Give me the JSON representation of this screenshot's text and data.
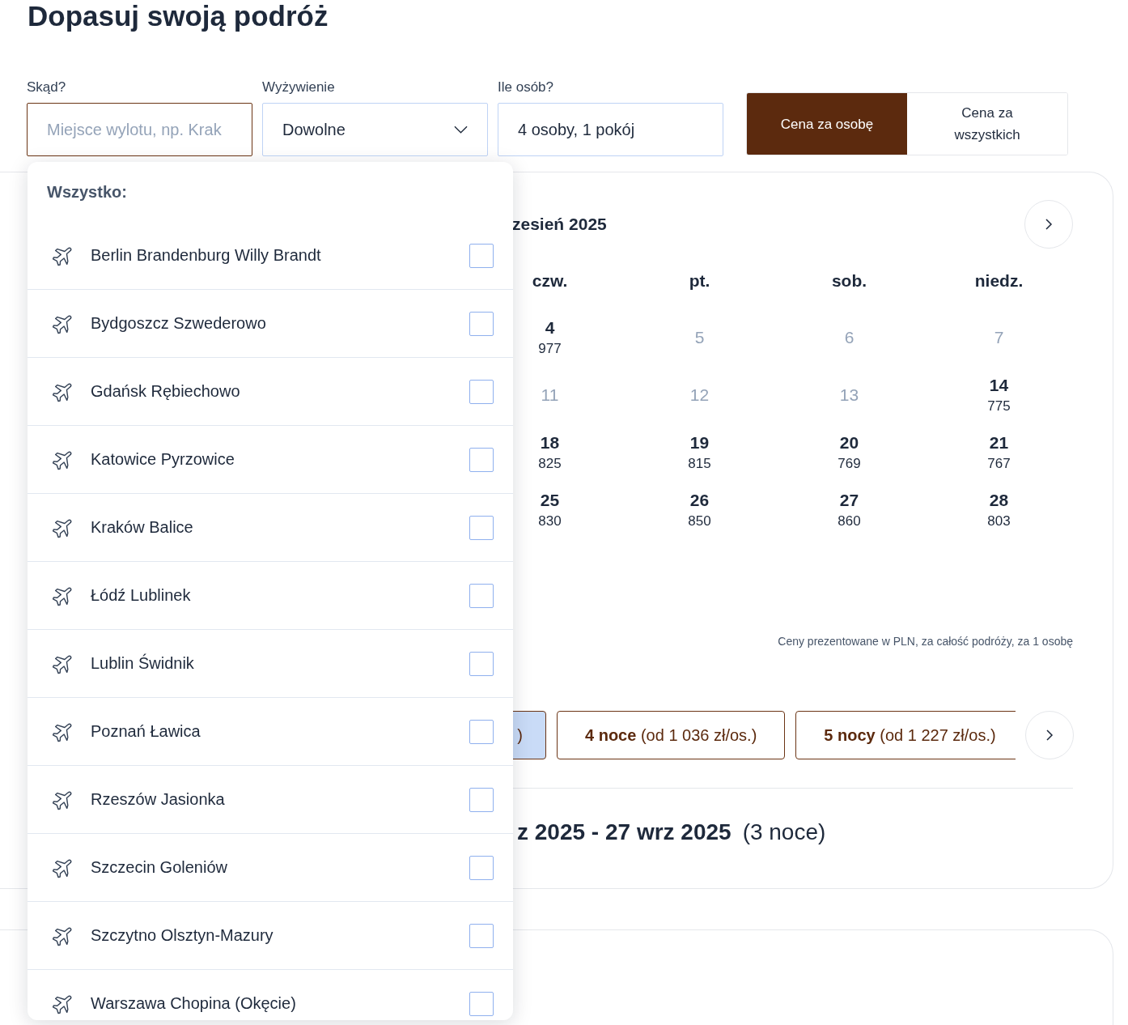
{
  "page_title": "Dopasuj swoją podróż",
  "fields": [
    {
      "label": "Skąd?",
      "kind": "input",
      "placeholder": "Miejsce wylotu, np. Krak"
    },
    {
      "label": "Wyżywienie",
      "kind": "select",
      "value": "Dowolne"
    },
    {
      "label": "Ile osób?",
      "kind": "text",
      "value": "4 osoby, 1 pokój"
    }
  ],
  "price_mode": [
    {
      "label": "Cena za osobę",
      "selected": true
    },
    {
      "label": "Cena za wszystkich",
      "selected": false
    }
  ],
  "departure_dropdown": {
    "heading": "Wszystko:",
    "items": [
      {
        "name": "Berlin Brandenburg Willy Brandt",
        "checked": false
      },
      {
        "name": "Bydgoszcz Szwederowo",
        "checked": false
      },
      {
        "name": "Gdańsk Rębiechowo",
        "checked": false
      },
      {
        "name": "Katowice Pyrzowice",
        "checked": false
      },
      {
        "name": "Kraków Balice",
        "checked": false
      },
      {
        "name": "Łódź Lublinek",
        "checked": false
      },
      {
        "name": "Lublin Świdnik",
        "checked": false
      },
      {
        "name": "Poznań Ławica",
        "checked": false
      },
      {
        "name": "Rzeszów Jasionka",
        "checked": false
      },
      {
        "name": "Szczecin Goleniów",
        "checked": false
      },
      {
        "name": "Szczytno Olsztyn-Mazury",
        "checked": false
      },
      {
        "name": "Warszawa Chopina (Okęcie)",
        "checked": false
      }
    ]
  },
  "calendar": {
    "month": "zesień 2025",
    "weekdays": [
      "czw.",
      "pt.",
      "sob.",
      "niedz."
    ],
    "weeks": [
      [
        {
          "day": "4",
          "price": "977",
          "available": true
        },
        {
          "day": "5",
          "available": false
        },
        {
          "day": "6",
          "available": false
        },
        {
          "day": "7",
          "available": false
        }
      ],
      [
        {
          "day": "11",
          "available": false
        },
        {
          "day": "12",
          "available": false
        },
        {
          "day": "13",
          "available": false
        },
        {
          "day": "14",
          "price": "775",
          "available": true
        }
      ],
      [
        {
          "day": "18",
          "price": "825",
          "available": true
        },
        {
          "day": "19",
          "price": "815",
          "available": true
        },
        {
          "day": "20",
          "price": "769",
          "available": true
        },
        {
          "day": "21",
          "price": "767",
          "available": true
        }
      ],
      [
        {
          "day": "25",
          "price": "830",
          "available": true
        },
        {
          "day": "26",
          "price": "850",
          "available": true
        },
        {
          "day": "27",
          "price": "860",
          "available": true
        },
        {
          "day": "28",
          "price": "803",
          "available": true
        }
      ]
    ]
  },
  "price_note": "Ceny prezentowane w PLN, za całość podróży, za 1 osobę",
  "nights": [
    {
      "price": ")",
      "selected": true
    },
    {
      "label": "4 noce",
      "price": "(od 1 036 zł/os.)",
      "selected": false
    },
    {
      "label": "5 nocy",
      "price": "(od 1 227 zł/os.)",
      "selected": false
    }
  ],
  "selected_range": {
    "dates": "z 2025 - 27 wrz 2025",
    "nights": "(3 noce)"
  }
}
